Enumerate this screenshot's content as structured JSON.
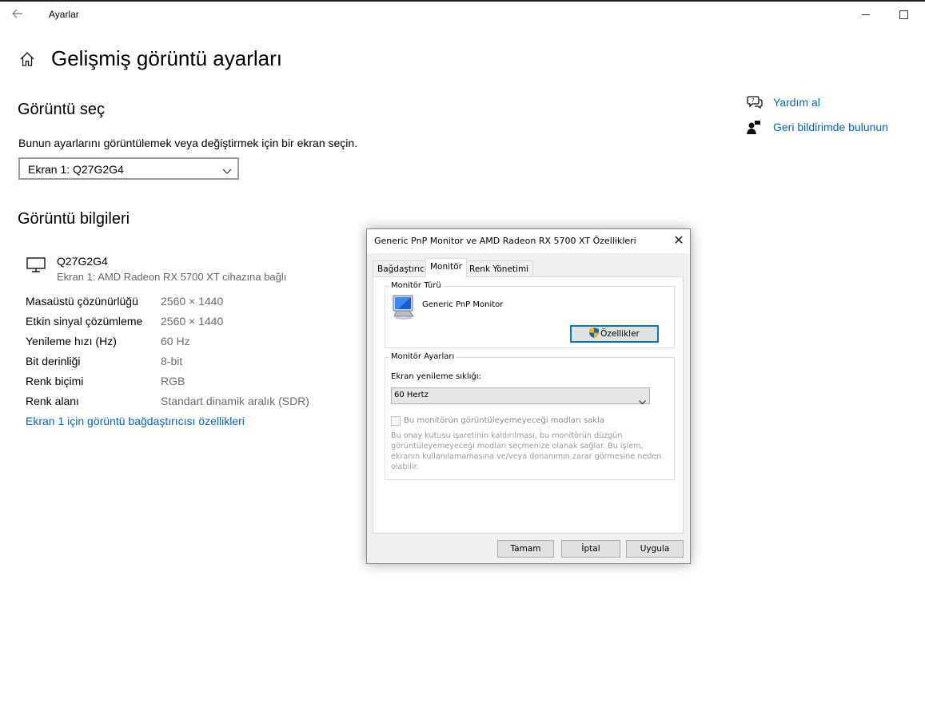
{
  "window": {
    "back_icon": "back-arrow-icon",
    "title": "Ayarlar"
  },
  "page": {
    "title": "Gelişmiş görüntü ayarları"
  },
  "select_section": {
    "heading": "Görüntü seç",
    "description": "Bunun ayarlarını görüntülemek veya değiştirmek için bir ekran seçin.",
    "selected": "Ekran 1: Q27G2G4"
  },
  "help": {
    "get_help": "Yardım al",
    "feedback": "Geri bildirimde bulunun"
  },
  "info_section": {
    "heading": "Görüntü bilgileri",
    "monitor_name": "Q27G2G4",
    "monitor_sub": "Ekran 1: AMD Radeon RX 5700 XT cihazına bağlı",
    "rows": [
      {
        "key": "Masaüstü çözünürlüğü",
        "value": "2560 × 1440"
      },
      {
        "key": "Etkin sinyal çözümleme",
        "value": "2560 × 1440"
      },
      {
        "key": "Yenileme hızı (Hz)",
        "value": "60 Hz"
      },
      {
        "key": "Bit derinliği",
        "value": "8-bit"
      },
      {
        "key": "Renk biçimi",
        "value": "RGB"
      },
      {
        "key": "Renk alanı",
        "value": "Standart dinamik aralık (SDR)"
      }
    ],
    "adapter_link": "Ekran 1 için görüntü bağdaştırıcısı özellikleri"
  },
  "dialog": {
    "title": "Generic PnP Monitor ve AMD Radeon RX 5700 XT Özellikleri",
    "close": "✕",
    "tabs": [
      "Bağdaştırıcı",
      "Monitör",
      "Renk Yönetimi"
    ],
    "monitor_type_label": "Monitör Türü",
    "monitor_type_name": "Generic PnP Monitor",
    "properties_button": "Özellikler",
    "monitor_settings_label": "Monitör Ayarları",
    "refresh_label": "Ekran yenileme sıklığı:",
    "refresh_value": "60 Hertz",
    "hide_modes_label": "Bu monitörün görüntüleyemeyeceği modları sakla",
    "hide_modes_checked": false,
    "warning": "Bu onay kutusu işaretinin kaldırılması, bu monitörün düzgün görüntüleyemeyeceği modları seçmenize olanak sağlar. Bu işlem, ekranın kullanılamamasına ve/veya donanımın zarar görmesine neden olabilir.",
    "ok": "Tamam",
    "cancel": "İptal",
    "apply": "Uygula"
  }
}
